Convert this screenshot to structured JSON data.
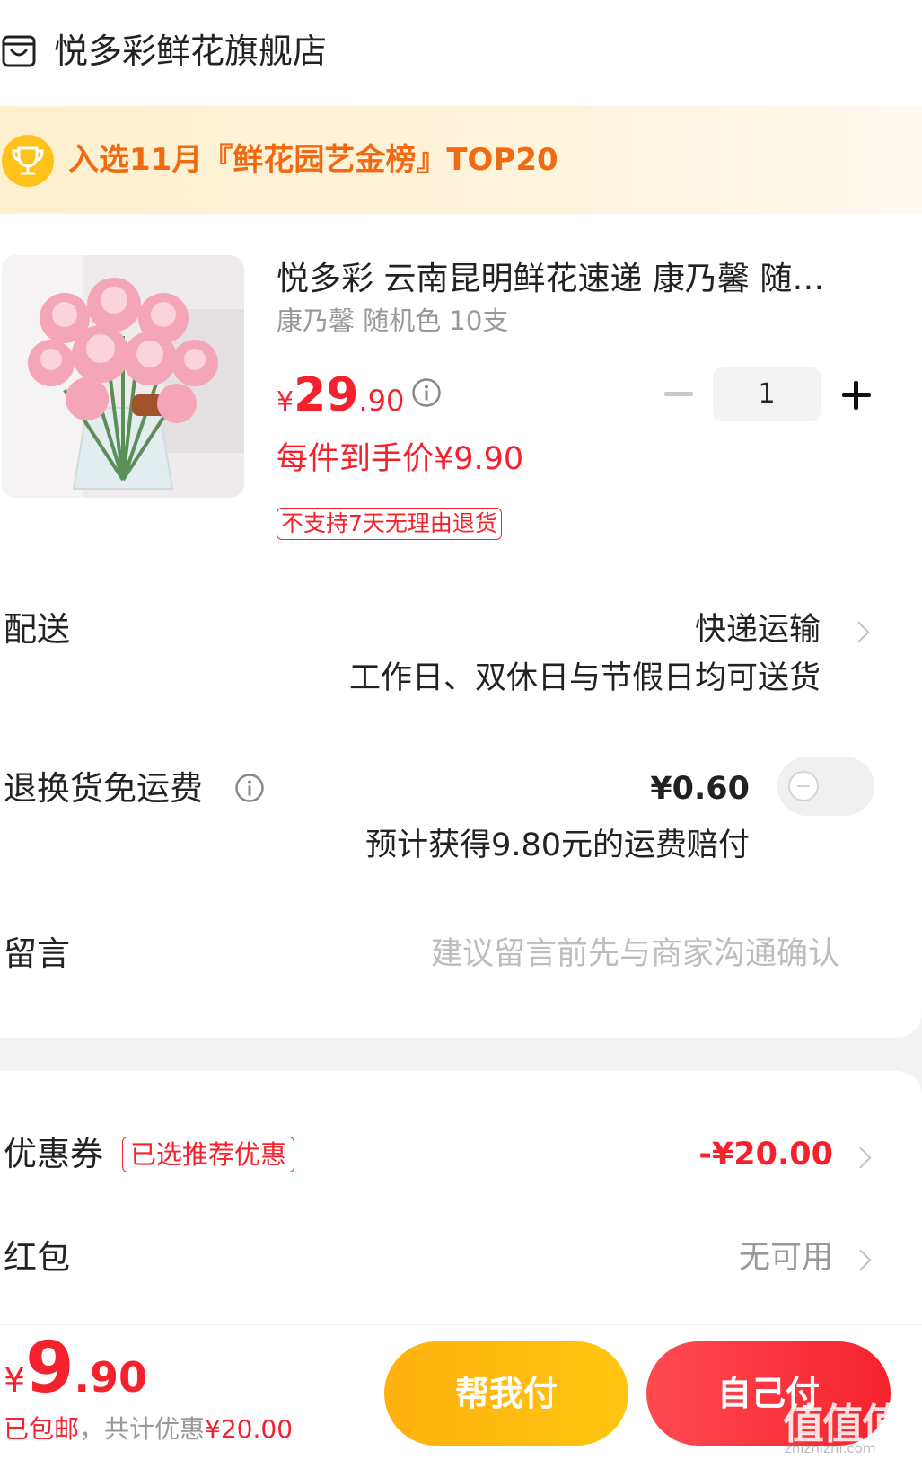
{
  "store": {
    "name": "悦多彩鲜花旗舰店",
    "icon": "store-icon"
  },
  "banner": {
    "text": "入选11月『鲜花园艺金榜』TOP20",
    "icon": "trophy-icon"
  },
  "product": {
    "title": "悦多彩 云南昆明鲜花速递 康乃馨 随…",
    "sku": "康乃馨 随机色 10支",
    "price_symbol": "¥",
    "price_int": "29",
    "price_dec": ".90",
    "quantity": "1",
    "unit_price": "每件到手价¥9.90",
    "no_return_tag": "不支持7天无理由退货"
  },
  "delivery": {
    "label": "配送",
    "method": "快递运输",
    "note": "工作日、双休日与节假日均可送货"
  },
  "return_shipping": {
    "label": "退换货免运费",
    "price": "¥0.60",
    "note": "预计获得9.80元的运费赔付",
    "toggle_on": false
  },
  "message": {
    "label": "留言",
    "placeholder": "建议留言前先与商家沟通确认"
  },
  "coupon": {
    "label": "优惠券",
    "tag": "已选推荐优惠",
    "value": "-¥20.00"
  },
  "red_packet": {
    "label": "红包",
    "value": "无可用"
  },
  "footer": {
    "total_symbol": "¥",
    "total_int": "9",
    "total_dec": ".90",
    "shipping_note": "已包邮",
    "discount_note": "，共计优惠",
    "discount_value": "¥20.00",
    "help_pay_label": "帮我付",
    "self_pay_label": "自己付",
    "watermark": "值值值",
    "watermark_url": "zhizhizhi.com"
  },
  "colors": {
    "accent_red": "#f5222d",
    "banner_orange": "#f06a14",
    "help_yellow": "#ffb10f"
  }
}
